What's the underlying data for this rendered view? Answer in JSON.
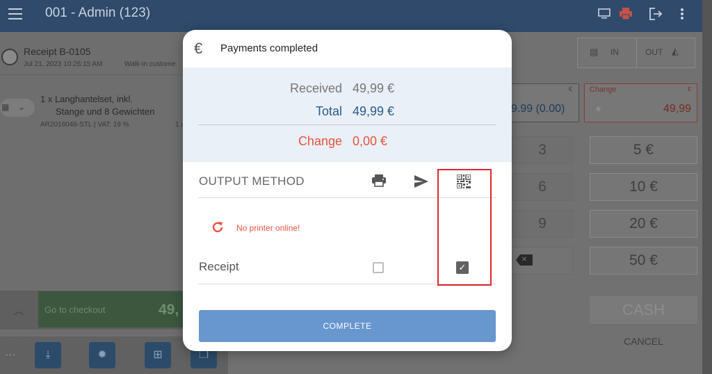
{
  "app": {
    "title": "001 - Admin (123)"
  },
  "left": {
    "receipt_title": "Receipt B-0105",
    "receipt_date": "Jul 21, 2023 10:26:15 AM",
    "receipt_customer": "Walk-in custome",
    "item_line1": "1 x Langhantelset, inkl.",
    "item_line2": "Stange und 8 Gewichten",
    "item_meta": "AR2016046-STL | VAT: 19 %",
    "item_meta2": "1 x",
    "checkout_label": "Go to checkout",
    "checkout_amount": "49,"
  },
  "right": {
    "in_label": "IN",
    "out_label": "OUT",
    "given_currency": "€",
    "given_value": "9.99 (0.00)",
    "change_label": "Change",
    "change_currency": "€",
    "change_value": "49,99",
    "keys": [
      "3",
      "6",
      "9"
    ],
    "amounts": [
      "5 €",
      "10 €",
      "20 €",
      "50 €"
    ],
    "cash_label": "CASH",
    "cancel_label": "CANCEL"
  },
  "modal": {
    "currency_symbol": "€",
    "title": "Payments completed",
    "received_label": "Received",
    "received_value": "49,99 €",
    "total_label": "Total",
    "total_value": "49,99 €",
    "change_label": "Change",
    "change_value": "0,00 €",
    "output_method_label": "OUTPUT METHOD",
    "error_text": "No printer online!",
    "receipt_label": "Receipt",
    "receipt_print_checked": false,
    "receipt_qr_checked": true,
    "complete_label": "COMPLETE",
    "colors": {
      "total": "#2c5a8c",
      "received": "#777777",
      "change": "#e8533f",
      "button": "#6896cf",
      "highlight": "#e0282e"
    }
  }
}
